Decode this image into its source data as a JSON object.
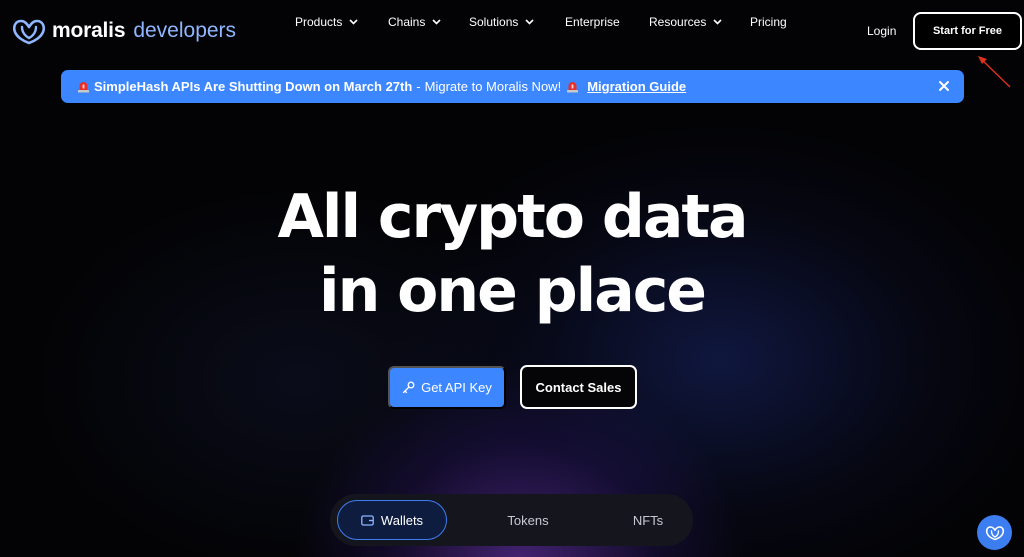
{
  "nav": {
    "brand": "moralis",
    "brand_sub": "developers",
    "menu": {
      "products": "Products",
      "chains": "Chains",
      "solutions": "Solutions",
      "enterprise": "Enterprise",
      "resources": "Resources",
      "pricing": "Pricing"
    },
    "login": "Login",
    "cta": "Start for Free"
  },
  "banner": {
    "headline": "SimpleHash APIs Are Shutting Down on March 27th",
    "separator": "-",
    "message": "Migrate to Moralis Now!",
    "link": "Migration Guide"
  },
  "hero": {
    "line1": "All crypto data",
    "line2": "in one place"
  },
  "buttons": {
    "api_key": "Get API Key",
    "contact_sales": "Contact Sales"
  },
  "tabs": {
    "wallets": "Wallets",
    "tokens": "Tokens",
    "nfts": "NFTs"
  },
  "icons": {
    "logo": "moralis-heart-logo-icon",
    "chevron": "chevron-down-icon",
    "siren": "siren-icon",
    "close": "close-icon",
    "key": "key-icon",
    "wallet": "wallet-icon",
    "chat": "chat-icon"
  },
  "colors": {
    "accent": "#3c86ff",
    "brand_sub": "#8fb6ff",
    "background": "#030305",
    "annotation_arrow": "#e0301e"
  }
}
